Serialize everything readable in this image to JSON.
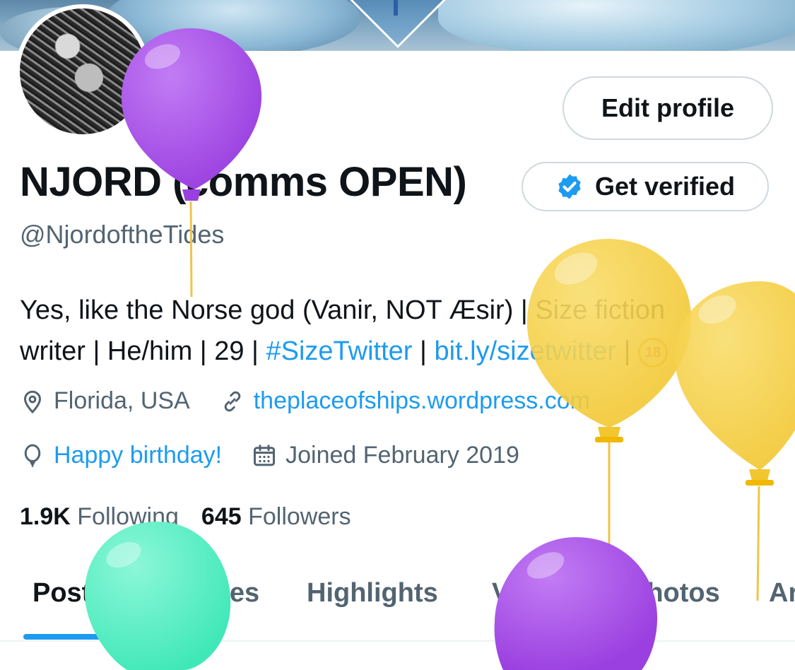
{
  "profile": {
    "display_name": "NJORD (comms OPEN)",
    "handle": "@NjordoftheTides",
    "bio": {
      "line1_text": "Yes, like the Norse god (Vanir, NOT Æsir) | Size fiction",
      "line2_prefix": "writer | He/him | 29 | ",
      "hashtag": "#SizeTwitter",
      "separator": " | ",
      "link": "bit.ly/sizetwitter",
      "separator2": " | ",
      "emoji_label": "18"
    },
    "location": "Florida, USA",
    "website": "theplaceofships.wordpress.com",
    "birthday": "Happy birthday!",
    "joined": "Joined February 2019"
  },
  "stats": {
    "following_count": "1.9K",
    "following_label": "Following",
    "followers_count": "645",
    "followers_label": "Followers"
  },
  "buttons": {
    "edit_profile": "Edit profile",
    "get_verified": "Get verified"
  },
  "tabs": [
    {
      "label": "Posts",
      "active": true
    },
    {
      "label": "Replies",
      "active": false
    },
    {
      "label": "Highlights",
      "active": false
    },
    {
      "label": "Videos",
      "active": false
    },
    {
      "label": "Photos",
      "active": false
    },
    {
      "label": "Ar",
      "active": false
    }
  ],
  "icons": {
    "location": "map-pin-icon",
    "website": "link-icon",
    "birthday": "balloon-icon",
    "joined": "calendar-icon",
    "verified": "verified-badge-icon"
  },
  "colors": {
    "accent": "#1d9bf0",
    "text": "#0f1419",
    "muted": "#536471",
    "balloon_purple": "#a04be0",
    "balloon_yellow": "#f5cc3a",
    "balloon_green": "#4ff0c0"
  }
}
